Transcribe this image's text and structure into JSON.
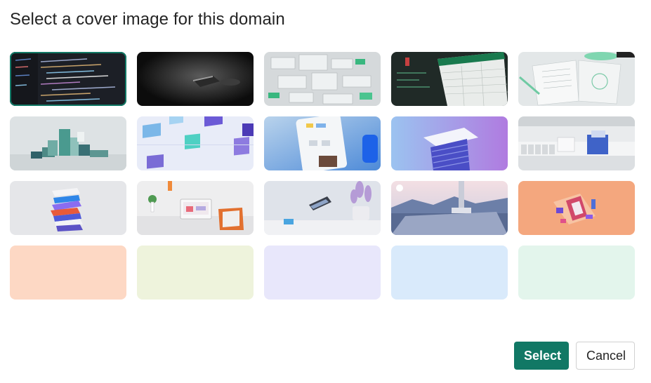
{
  "dialog": {
    "title": "Select a cover image for this domain"
  },
  "cover_images": [
    {
      "name": "code-editor",
      "selected": true
    },
    {
      "name": "dark-device",
      "selected": false
    },
    {
      "name": "glass-chips",
      "selected": false
    },
    {
      "name": "spreadsheet",
      "selected": false
    },
    {
      "name": "open-book",
      "selected": false
    },
    {
      "name": "teal-blocks",
      "selected": false
    },
    {
      "name": "glass-cubes",
      "selected": false
    },
    {
      "name": "phone-app",
      "selected": false
    },
    {
      "name": "purple-stack",
      "selected": false
    },
    {
      "name": "office-desk",
      "selected": false
    },
    {
      "name": "color-stack",
      "selected": false
    },
    {
      "name": "laptop-workspace",
      "selected": false
    },
    {
      "name": "floating-device",
      "selected": false
    },
    {
      "name": "mountain-landscape",
      "selected": false
    },
    {
      "name": "orange-illustration",
      "selected": false
    }
  ],
  "solid_colors": [
    "#fdd8c4",
    "#eef3dc",
    "#e8e7fb",
    "#d9eafb",
    "#e3f5ec"
  ],
  "colors": {
    "accent": "#117865",
    "title_text": "#242424",
    "border": "#d1d1d1"
  },
  "buttons": {
    "select_label": "Select",
    "cancel_label": "Cancel"
  }
}
